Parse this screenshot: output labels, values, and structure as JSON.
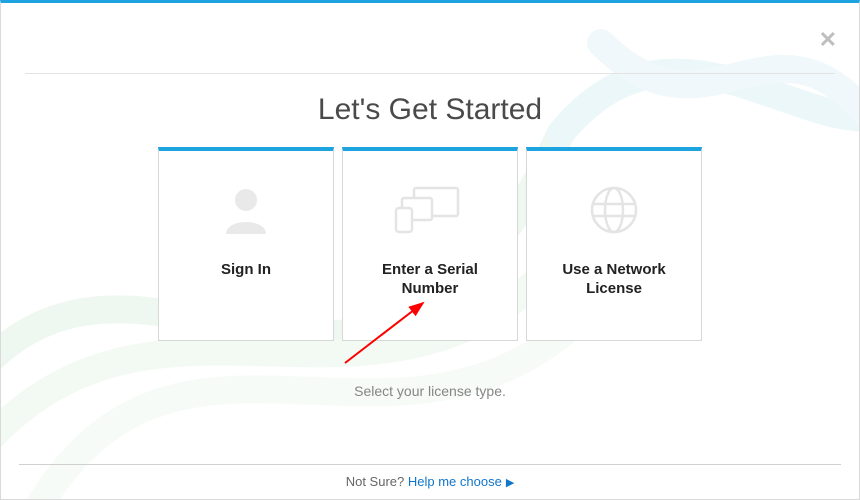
{
  "heading": "Let's Get Started",
  "cards": [
    {
      "id": "sign-in",
      "title": "Sign In",
      "icon": "person-icon"
    },
    {
      "id": "serial-number",
      "title": "Enter a Serial Number",
      "icon": "devices-icon"
    },
    {
      "id": "network",
      "title": "Use a Network License",
      "icon": "globe-network-icon"
    }
  ],
  "helper_text": "Select your license type.",
  "footer": {
    "prefix": "Not Sure? ",
    "link_text": "Help me choose"
  },
  "colors": {
    "accent": "#1ca3e0",
    "link": "#1276c9"
  }
}
